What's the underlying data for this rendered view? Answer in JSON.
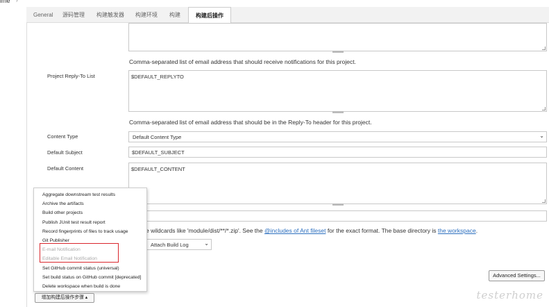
{
  "breadcrumb": {
    "text": "ime",
    "arrow": "›"
  },
  "tabs": [
    {
      "label": "General",
      "active": false
    },
    {
      "label": "源码管理",
      "active": false
    },
    {
      "label": "构建触发器",
      "active": false
    },
    {
      "label": "构建环境",
      "active": false
    },
    {
      "label": "构建",
      "active": false
    },
    {
      "label": "构建后操作",
      "active": true
    }
  ],
  "recipients": {
    "help": "Comma-separated list of email address that should receive notifications for this project."
  },
  "reply_to": {
    "label": "Project Reply-To List",
    "value": "$DEFAULT_REPLYTO",
    "help": "Comma-separated list of email address that should be in the Reply-To header for this project."
  },
  "content_type": {
    "label": "Content Type",
    "value": "Default Content Type"
  },
  "default_subject": {
    "label": "Default Subject",
    "value": "$DEFAULT_SUBJECT"
  },
  "default_content": {
    "label": "Default Content",
    "value": "$DEFAULT_CONTENT"
  },
  "attachments": {
    "help_prefix": "e wildcards like 'module/dist/**/*.zip'. See the ",
    "help_link1": "@includes of Ant fileset",
    "help_middle": " for the exact format. The base directory is ",
    "help_link2": "the workspace",
    "help_suffix": "."
  },
  "attach_build_log": {
    "value": "Attach Build Log"
  },
  "advanced_button": "Advanced Settings...",
  "add_post_build_button": "增加构建后操作步骤 ▴",
  "menu_items": [
    {
      "label": "Aggregate downstream test results",
      "disabled": false
    },
    {
      "label": "Archive the artifacts",
      "disabled": false
    },
    {
      "label": "Build other projects",
      "disabled": false
    },
    {
      "label": "Publish JUnit test result report",
      "disabled": false
    },
    {
      "label": "Record fingerprints of files to track usage",
      "disabled": false
    },
    {
      "label": "Git Publisher",
      "disabled": false
    },
    {
      "label": "E-mail Notification",
      "disabled": true
    },
    {
      "label": "Editable Email Notification",
      "disabled": true
    },
    {
      "label": "Set GitHub commit status (universal)",
      "disabled": false
    },
    {
      "label": "Set build status on GitHub commit [deprecated]",
      "disabled": false
    },
    {
      "label": "Delete workspace when build is done",
      "disabled": false
    }
  ],
  "watermark": "testerhome"
}
